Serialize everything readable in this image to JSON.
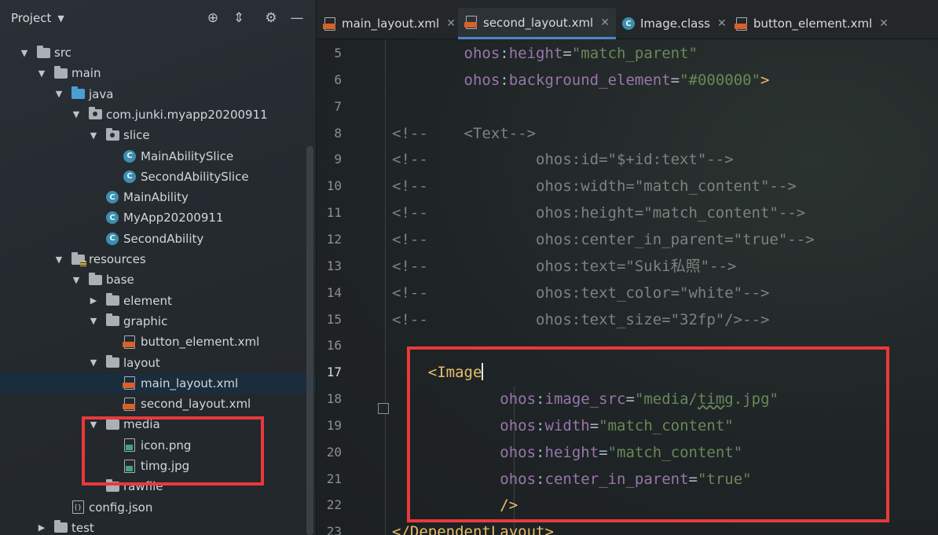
{
  "project_panel": {
    "title": "Project",
    "tree": [
      {
        "label": "src",
        "depth": 0,
        "state": "open",
        "icon": "folder-icon"
      },
      {
        "label": "main",
        "depth": 1,
        "state": "open",
        "icon": "folder-icon"
      },
      {
        "label": "java",
        "depth": 2,
        "state": "open",
        "icon": "source-folder-icon"
      },
      {
        "label": "com.junki.myapp20200911",
        "depth": 3,
        "state": "open",
        "icon": "package-icon"
      },
      {
        "label": "slice",
        "depth": 4,
        "state": "open",
        "icon": "package-icon"
      },
      {
        "label": "MainAbilitySlice",
        "depth": 5,
        "state": "leaf",
        "icon": "class-icon"
      },
      {
        "label": "SecondAbilitySlice",
        "depth": 5,
        "state": "leaf",
        "icon": "class-icon"
      },
      {
        "label": "MainAbility",
        "depth": 4,
        "state": "leaf",
        "icon": "class-icon"
      },
      {
        "label": "MyApp20200911",
        "depth": 4,
        "state": "leaf",
        "icon": "class-icon"
      },
      {
        "label": "SecondAbility",
        "depth": 4,
        "state": "leaf",
        "icon": "class-icon"
      },
      {
        "label": "resources",
        "depth": 2,
        "state": "open",
        "icon": "resources-folder-icon"
      },
      {
        "label": "base",
        "depth": 3,
        "state": "open",
        "icon": "folder-icon"
      },
      {
        "label": "element",
        "depth": 4,
        "state": "closed",
        "icon": "folder-icon"
      },
      {
        "label": "graphic",
        "depth": 4,
        "state": "open",
        "icon": "folder-icon"
      },
      {
        "label": "button_element.xml",
        "depth": 5,
        "state": "leaf",
        "icon": "xml-file-icon"
      },
      {
        "label": "layout",
        "depth": 4,
        "state": "open",
        "icon": "folder-icon"
      },
      {
        "label": "main_layout.xml",
        "depth": 5,
        "state": "leaf",
        "icon": "xml-file-icon",
        "selected": true
      },
      {
        "label": "second_layout.xml",
        "depth": 5,
        "state": "leaf",
        "icon": "xml-file-icon"
      },
      {
        "label": "media",
        "depth": 4,
        "state": "open",
        "icon": "folder-icon"
      },
      {
        "label": "icon.png",
        "depth": 5,
        "state": "leaf",
        "icon": "image-file-icon"
      },
      {
        "label": "timg.jpg",
        "depth": 5,
        "state": "leaf",
        "icon": "image-file-icon"
      },
      {
        "label": "rawfile",
        "depth": 4,
        "state": "none",
        "icon": "folder-icon"
      },
      {
        "label": "config.json",
        "depth": 2,
        "state": "none",
        "icon": "json-file-icon"
      },
      {
        "label": "test",
        "depth": 1,
        "state": "closed",
        "icon": "folder-icon"
      }
    ]
  },
  "tabs": [
    {
      "label": "main_layout.xml",
      "icon": "xml-file-icon",
      "active": false
    },
    {
      "label": "second_layout.xml",
      "icon": "xml-file-icon",
      "active": true
    },
    {
      "label": "Image.class",
      "icon": "class-icon",
      "active": false
    },
    {
      "label": "button_element.xml",
      "icon": "xml-file-icon",
      "active": false
    }
  ],
  "editor": {
    "current_line": "17",
    "lines": [
      {
        "n": "5",
        "tokens": [
          {
            "t": "        ",
            "c": "punc"
          },
          {
            "t": "ohos",
            "c": "attr"
          },
          {
            "t": ":",
            "c": "punc"
          },
          {
            "t": "height",
            "c": "attr"
          },
          {
            "t": "=",
            "c": "punc"
          },
          {
            "t": "\"match_parent\"",
            "c": "str"
          }
        ]
      },
      {
        "n": "6",
        "tokens": [
          {
            "t": "        ",
            "c": "punc"
          },
          {
            "t": "ohos",
            "c": "attr"
          },
          {
            "t": ":",
            "c": "punc"
          },
          {
            "t": "background_element",
            "c": "attr"
          },
          {
            "t": "=",
            "c": "punc"
          },
          {
            "t": "\"#000000\"",
            "c": "str"
          },
          {
            "t": ">",
            "c": "tag"
          }
        ]
      },
      {
        "n": "7",
        "tokens": []
      },
      {
        "n": "8",
        "tokens": [
          {
            "t": "<!--    <Text-->",
            "c": "cmt"
          }
        ]
      },
      {
        "n": "9",
        "tokens": [
          {
            "t": "<!--            ohos:id=\"$+id:text\"-->",
            "c": "cmt"
          }
        ]
      },
      {
        "n": "10",
        "tokens": [
          {
            "t": "<!--            ohos:width=\"match_content\"-->",
            "c": "cmt"
          }
        ]
      },
      {
        "n": "11",
        "tokens": [
          {
            "t": "<!--            ohos:height=\"match_content\"-->",
            "c": "cmt"
          }
        ]
      },
      {
        "n": "12",
        "tokens": [
          {
            "t": "<!--            ohos:center_in_parent=\"true\"-->",
            "c": "cmt"
          }
        ]
      },
      {
        "n": "13",
        "tokens": [
          {
            "t": "<!--            ohos:text=\"Suki私照\"-->",
            "c": "cmt"
          }
        ]
      },
      {
        "n": "14",
        "tokens": [
          {
            "t": "<!--            ohos:text_color=\"white\"-->",
            "c": "cmt"
          }
        ]
      },
      {
        "n": "15",
        "tokens": [
          {
            "t": "<!--            ohos:text_size=\"32fp\"/>-->",
            "c": "cmt"
          }
        ]
      },
      {
        "n": "16",
        "tokens": []
      },
      {
        "n": "17",
        "tokens": [
          {
            "t": "    ",
            "c": "punc"
          },
          {
            "t": "<Image",
            "c": "tag"
          },
          {
            "t": "",
            "c": "caret"
          }
        ]
      },
      {
        "n": "18",
        "tokens": [
          {
            "t": "            ",
            "c": "punc"
          },
          {
            "t": "ohos",
            "c": "attr"
          },
          {
            "t": ":",
            "c": "punc"
          },
          {
            "t": "image_src",
            "c": "attr"
          },
          {
            "t": "=",
            "c": "punc"
          },
          {
            "t": "\"media/",
            "c": "str"
          },
          {
            "t": "timg",
            "c": "str squiggle"
          },
          {
            "t": ".jpg\"",
            "c": "str"
          }
        ]
      },
      {
        "n": "19",
        "tokens": [
          {
            "t": "            ",
            "c": "punc"
          },
          {
            "t": "ohos",
            "c": "attr"
          },
          {
            "t": ":",
            "c": "punc"
          },
          {
            "t": "width",
            "c": "attr"
          },
          {
            "t": "=",
            "c": "punc"
          },
          {
            "t": "\"match_content\"",
            "c": "str"
          }
        ]
      },
      {
        "n": "20",
        "tokens": [
          {
            "t": "            ",
            "c": "punc"
          },
          {
            "t": "ohos",
            "c": "attr"
          },
          {
            "t": ":",
            "c": "punc"
          },
          {
            "t": "height",
            "c": "attr"
          },
          {
            "t": "=",
            "c": "punc"
          },
          {
            "t": "\"match_content\"",
            "c": "str"
          }
        ]
      },
      {
        "n": "21",
        "tokens": [
          {
            "t": "            ",
            "c": "punc"
          },
          {
            "t": "ohos",
            "c": "attr"
          },
          {
            "t": ":",
            "c": "punc"
          },
          {
            "t": "center_in_parent",
            "c": "attr"
          },
          {
            "t": "=",
            "c": "punc"
          },
          {
            "t": "\"true\"",
            "c": "str"
          }
        ]
      },
      {
        "n": "22",
        "tokens": [
          {
            "t": "            ",
            "c": "punc"
          },
          {
            "t": "/>",
            "c": "tag"
          }
        ]
      },
      {
        "n": "23",
        "tokens": [
          {
            "t": "</DependentLayout>",
            "c": "tag"
          }
        ]
      }
    ]
  },
  "colors": {
    "attribute": "#9876aa",
    "string": "#6a8759",
    "tag": "#e8bf6a",
    "comment": "#808080",
    "annotation": "#e8393b",
    "active_tab": "#4a88c7"
  }
}
